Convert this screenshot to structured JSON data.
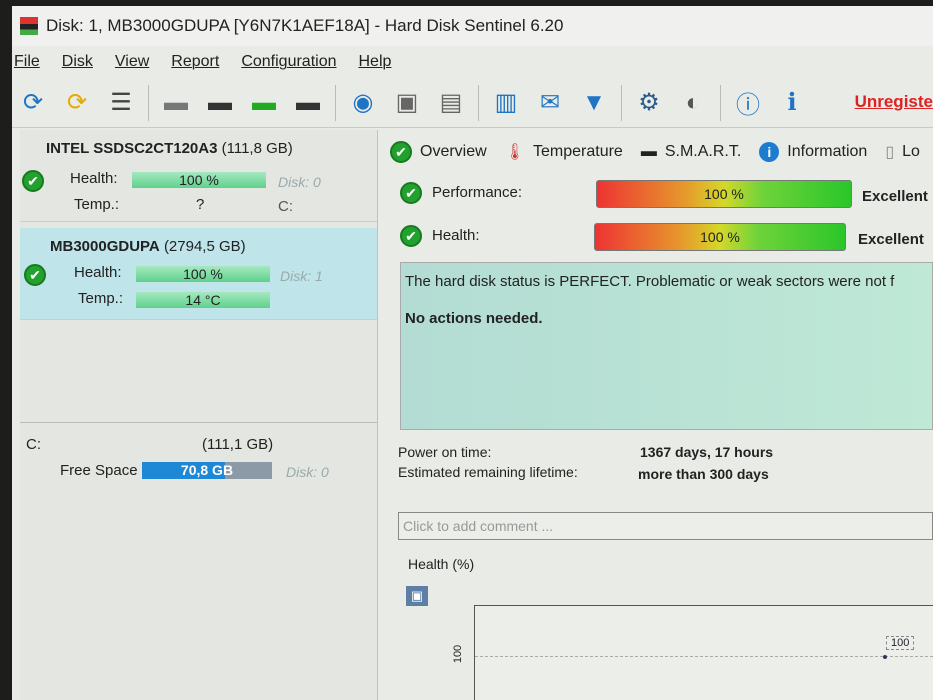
{
  "window": {
    "title": "Disk: 1, MB3000GDUPA [Y6N7K1AEF18A]  -  Hard Disk Sentinel 6.20"
  },
  "menu": [
    "File",
    "Disk",
    "View",
    "Report",
    "Configuration",
    "Help"
  ],
  "toolbar": {
    "icons": [
      "refresh-icon",
      "refresh-warning-icon",
      "disk-list-icon",
      "disk-icon",
      "disk-schedule-icon",
      "disk-check-icon",
      "disk-search-icon",
      "globe-disk-icon",
      "disk-copy-icon",
      "disk-tools-icon",
      "report-icon",
      "mail-icon",
      "network-icon",
      "settings-icon",
      "sound-icon",
      "help-icon",
      "info-icon"
    ],
    "unregistered": "Unregiste"
  },
  "disks": [
    {
      "model": "INTEL SSDSC2CT120A3",
      "size": "(111,8 GB)",
      "health_label": "Health:",
      "health": "100 %",
      "health_pct": 100,
      "temp_label": "Temp.:",
      "temp": "?",
      "disk": "Disk: 0",
      "drive": "C:"
    },
    {
      "model": "MB3000GDUPA",
      "size": "(2794,5 GB)",
      "health_label": "Health:",
      "health": "100 %",
      "health_pct": 100,
      "temp_label": "Temp.:",
      "temp": "14 °C",
      "disk": "Disk: 1"
    }
  ],
  "partition": {
    "drive": "C:",
    "size": "(111,1 GB)",
    "free_label": "Free Space",
    "free": "70,8 GB",
    "free_pct": 64,
    "disk": "Disk: 0"
  },
  "tabs": [
    "Overview",
    "Temperature",
    "S.M.A.R.T.",
    "Information",
    "Lo"
  ],
  "overview": {
    "performance_label": "Performance:",
    "performance": "100 %",
    "performance_rating": "Excellent",
    "health_label": "Health:",
    "health": "100 %",
    "health_rating": "Excellent",
    "status_text": "The hard disk status is PERFECT. Problematic or weak sectors were not f",
    "actions": "No actions needed.",
    "power_on_label": "Power on time:",
    "power_on": "1367 days, 17 hours",
    "lifetime_label": "Estimated remaining lifetime:",
    "lifetime": "more than 300 days",
    "comment_placeholder": "Click to add comment ..."
  },
  "chart_data": {
    "type": "line",
    "title": "Health (%)",
    "y_tick": "100",
    "values": [
      100
    ],
    "point_label": "100"
  }
}
